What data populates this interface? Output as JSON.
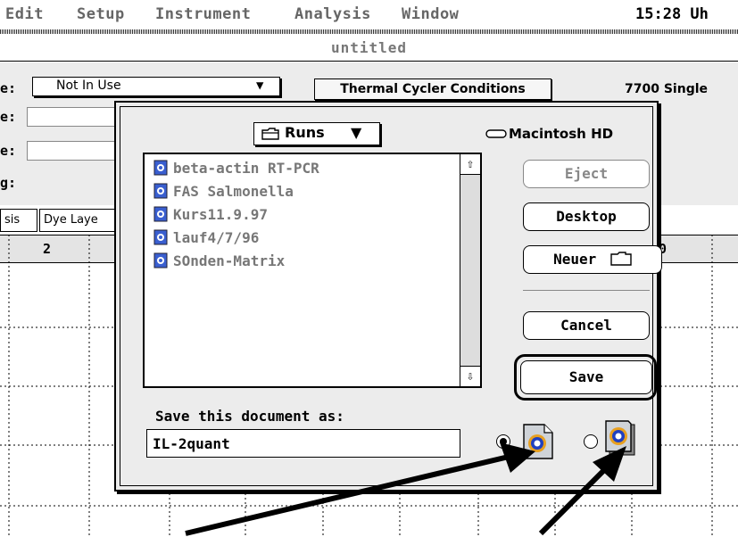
{
  "menubar": {
    "items": [
      "Edit",
      "Setup",
      "Instrument",
      "Analysis",
      "Window"
    ],
    "clock": "15:28 Uh"
  },
  "window": {
    "title": "untitled"
  },
  "background": {
    "row_labels": [
      "e:",
      "e:",
      "e:",
      "g:"
    ],
    "dropdown_value": "Not In Use",
    "thermal_button": "Thermal Cycler Conditions",
    "instrument": "7700 Single",
    "tabs": [
      "sis",
      "Dye Laye"
    ],
    "grid_headers": [
      "2",
      "0"
    ]
  },
  "dialog": {
    "folder": "Runs",
    "disk": "Macintosh HD",
    "files": [
      "beta-actin RT-PCR",
      "FAS Salmonella",
      "Kurs11.9.97",
      "lauf4/7/96",
      "SOnden-Matrix"
    ],
    "buttons": {
      "eject": "Eject",
      "desktop": "Desktop",
      "new_folder": "Neuer",
      "cancel": "Cancel",
      "save": "Save"
    },
    "prompt": "Save this document as:",
    "filename": "IL-2quant",
    "format_selected": "document"
  }
}
